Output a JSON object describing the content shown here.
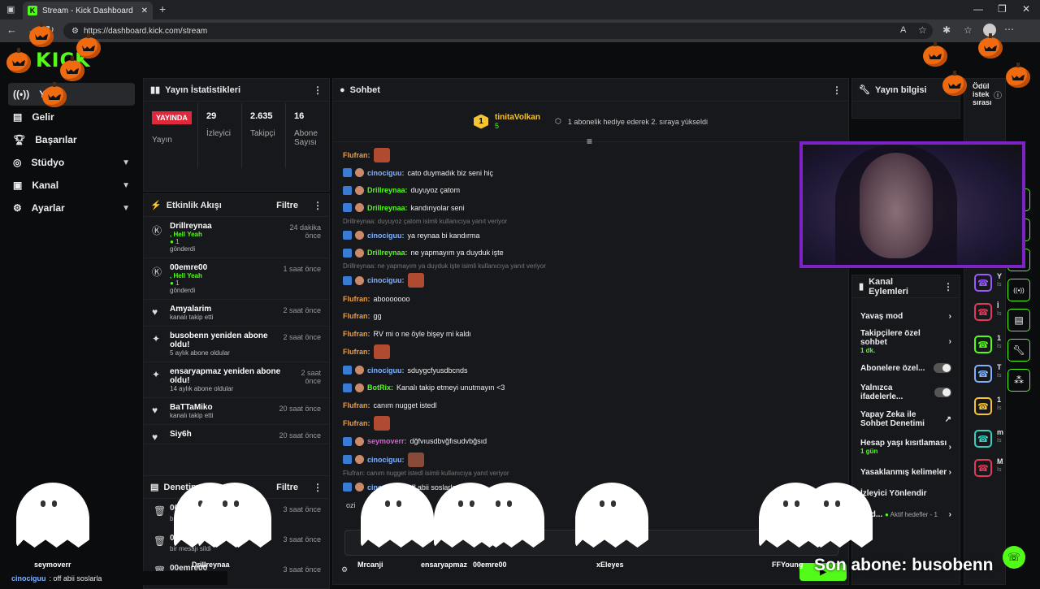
{
  "browser": {
    "tab_title": "Stream - Kick Dashboard",
    "url": "https://dashboard.kick.com/stream",
    "icons": [
      "back-icon",
      "forward-icon",
      "reload-icon",
      "tune-icon",
      "read-aloud-icon",
      "star-icon",
      "extensions-icon",
      "favorites-icon",
      "profile-icon",
      "more-icon"
    ]
  },
  "logo": "KICK",
  "sidebar": {
    "items": [
      {
        "label": "Yayın",
        "icon": "broadcast-icon",
        "active": true
      },
      {
        "label": "Gelir",
        "icon": "revenue-icon"
      },
      {
        "label": "Başarılar",
        "icon": "trophy-icon"
      },
      {
        "label": "Stüdyo",
        "icon": "studio-icon",
        "expandable": true
      },
      {
        "label": "Kanal",
        "icon": "channel-icon",
        "expandable": true
      },
      {
        "label": "Ayarlar",
        "icon": "settings-icon",
        "expandable": true
      }
    ]
  },
  "stats": {
    "title": "Yayın İstatistikleri",
    "live_badge": "YAYINDA",
    "live_label": "Yayın",
    "viewers": {
      "value": "29",
      "label": "İzleyici"
    },
    "followers": {
      "value": "2.635",
      "label": "Takipçi"
    },
    "subscribers": {
      "value": "16",
      "label": "Abone Sayısı"
    }
  },
  "activity": {
    "title": "Etkinlik Akışı",
    "filter": "Filtre",
    "items": [
      {
        "name": "Drillreynaa",
        "line2": ", Hell Yeah",
        "line3": "1",
        "line4": "gönderdi",
        "time": "24 dakika önce",
        "icon": "kick-icon"
      },
      {
        "name": "00emre00",
        "line2": ", Hell Yeah",
        "line3": "1",
        "line4": "gönderdi",
        "time": "1 saat önce",
        "icon": "kick-icon"
      },
      {
        "name": "Amyalarim",
        "line2": "kanalı takip etti",
        "time": "2 saat önce",
        "icon": "heart-icon"
      },
      {
        "name": "busobenn yeniden abone oldu!",
        "line2": "5 aylık abone oldular",
        "time": "2 saat önce",
        "icon": "sparkle-icon"
      },
      {
        "name": "ensaryapmaz yeniden abone oldu!",
        "line2": "14 aylık abone oldular",
        "time": "2 saat önce",
        "icon": "sparkle-icon"
      },
      {
        "name": "BaTTaMiko",
        "line2": "kanalı takip etti",
        "time": "20 saat önce",
        "icon": "heart-icon"
      },
      {
        "name": "Siy6h",
        "line2": "",
        "time": "20 saat önce",
        "icon": "heart-icon"
      }
    ]
  },
  "moderation": {
    "title": "Denetim Eylemleri",
    "filter": "Filtre",
    "items": [
      {
        "name": "00emre00",
        "sub": "bir mesajı sildi",
        "time": "3 saat önce"
      },
      {
        "name": "00emre00",
        "sub": "bir mesajı sildi",
        "time": "3 saat önce"
      },
      {
        "name": "00emre00",
        "sub": "",
        "time": "3 saat önce"
      }
    ]
  },
  "chat": {
    "title": "Sohbet",
    "pinned_user": "tinitaVolkan",
    "pinned_count": "5",
    "pinned_badge": "1",
    "pinned_text": "1 abonelik hediye ederek 2. sıraya yükseldi",
    "messages": [
      {
        "user": "Flufran",
        "text": "",
        "emote": true,
        "ucolor": "#f39c3a"
      },
      {
        "user": "cinociguu",
        "text": "cato duymadık biz seni hiç",
        "ucolor": "#7fb2ff",
        "badges": true
      },
      {
        "user": "Drillreynaa",
        "text": "duyuyoz çatom",
        "ucolor": "#53fc18",
        "badges": true
      },
      {
        "user": "Drillreynaa",
        "text": "kandırıyolar seni",
        "ucolor": "#53fc18",
        "badges": true
      },
      {
        "reply": "Drillreynaa: duyuyoz çatom isimli kullanıcıya yanıt veriyor"
      },
      {
        "user": "cinociguu",
        "text": "ya reynaa bi kandırma",
        "ucolor": "#7fb2ff",
        "badges": true
      },
      {
        "user": "Drillreynaa",
        "text": "ne yapmayım ya duyduk işte",
        "ucolor": "#53fc18",
        "badges": true
      },
      {
        "reply": "Drillreynaa: ne yapmayım ya duyduk işte isimli kullanıcıya yanıt veriyor"
      },
      {
        "user": "cinociguu",
        "text": "",
        "emote": true,
        "ucolor": "#7fb2ff",
        "badges": true
      },
      {
        "user": "Flufran",
        "text": "abooooooo",
        "ucolor": "#f39c3a"
      },
      {
        "user": "Flufran",
        "text": "gg",
        "ucolor": "#f39c3a"
      },
      {
        "user": "Flufran",
        "text": "RV mi o ne öyle bişey mi kaldı",
        "ucolor": "#f39c3a"
      },
      {
        "user": "Flufran",
        "text": "",
        "emote": true,
        "ucolor": "#f39c3a"
      },
      {
        "user": "cinociguu",
        "text": "sduygcfyusdbcnds",
        "ucolor": "#7fb2ff",
        "badges": true
      },
      {
        "user": "BotRix",
        "text": "Kanalı takip etmeyi unutmayın <3",
        "ucolor": "#53fc18",
        "badges": true
      },
      {
        "user": "Flufran",
        "text": "canım nugget istedl",
        "ucolor": "#f39c3a"
      },
      {
        "user": "Flufran",
        "text": "",
        "emote": true,
        "ucolor": "#f39c3a"
      },
      {
        "user": "seymoverr",
        "text": "dğfvıusdbvğfısudvbğsıd",
        "ucolor": "#e05bd8",
        "badges": true
      },
      {
        "user": "cinociguu",
        "text": "",
        "emote": true,
        "ucolor": "#7fb2ff",
        "badges": true
      },
      {
        "reply": "Flufran: canım nugget istedl isimli kullanıcıya yanıt veriyor"
      },
      {
        "user": "cinociguu",
        "text": "off abii soslarla",
        "ucolor": "#7fb2ff",
        "badges": true
      }
    ],
    "partial_text": "ozi"
  },
  "stream_info": {
    "title": "Yayın bilgisi",
    "reward_title": "Ödül istek sırası"
  },
  "channel_actions": {
    "title": "Kanal Eylemleri",
    "items": [
      {
        "label": "Yavaş mod",
        "type": "chevron"
      },
      {
        "label": "Takipçilere özel sohbet",
        "sub": "1 dk.",
        "type": "chevron"
      },
      {
        "label": "Abonelere özel...",
        "type": "toggle"
      },
      {
        "label": "Yalnızca ifadelerle...",
        "type": "toggle"
      },
      {
        "label": "Yapay Zeka ile Sohbet Denetimi",
        "type": "external"
      },
      {
        "label": "Hesap yaşı kısıtlaması",
        "sub": "1 gün",
        "type": "chevron"
      },
      {
        "label": "Yasaklanmış kelimeler",
        "type": "chevron"
      },
      {
        "label": "İzleyici Yönlendir",
        "type": "none"
      },
      {
        "label": "Hed...",
        "sub_inline": "Aktif hedefler - 1",
        "type": "chevron"
      }
    ]
  },
  "reward_queue": {
    "items": [
      {
        "letter": "Y",
        "sub": "İs",
        "color": "#9b59ff"
      },
      {
        "letter": "İ",
        "sub": "İs",
        "color": "#e03a5a"
      },
      {
        "letter": "1",
        "sub": "İs",
        "color": "#53fc18"
      },
      {
        "letter": "T",
        "sub": "İs",
        "color": "#7fb2ff"
      },
      {
        "letter": "1",
        "sub": "İs",
        "color": "#f6c431"
      },
      {
        "letter": "m",
        "sub": "İs",
        "color": "#35d0c0"
      },
      {
        "letter": "M",
        "sub": "İs",
        "color": "#e03a5a"
      }
    ]
  },
  "rail_icons": [
    "page-icon",
    "page-icon",
    "chat-bubble-icon",
    "broadcast-icon",
    "layout-icon",
    "wrench-icon",
    "nodes-icon"
  ],
  "overlay": {
    "ghost_names": [
      "seymoverr",
      "Drillreynaa",
      "Mrcanji",
      "ensaryapmaz",
      "00emre00",
      "xEleyes",
      "FFYoung"
    ],
    "last_sub_label": "Son abone: busobenn",
    "bottom_chat_user": "cinociguu",
    "bottom_chat_text": ": off abii soslarla"
  }
}
